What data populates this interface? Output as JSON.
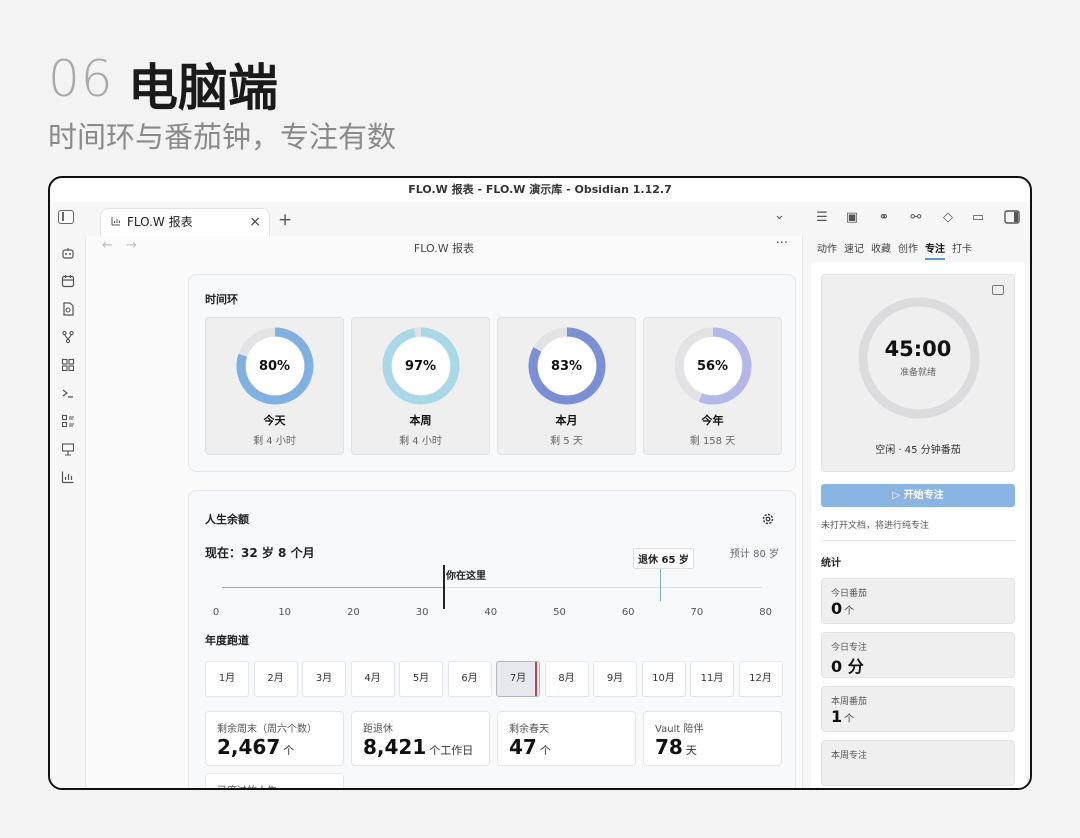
{
  "hero": {
    "number": "06",
    "title": "电脑端",
    "subtitle": "时间环与番茄钟，专注有数"
  },
  "window": {
    "title": "FLO.W 报表 - FLO.W 演示库 - Obsidian 1.12.7"
  },
  "tabs": {
    "active_label": "FLO.W 报表",
    "close": "×",
    "new": "+",
    "more": "⌄"
  },
  "navbar": {
    "back": "←",
    "forward": "→",
    "title": "FLO.W 报表",
    "more": "···"
  },
  "time_rings": {
    "title": "时间环",
    "items": [
      {
        "pct_label": "80%",
        "pct": 0.8,
        "label": "今天",
        "sub": "剩 4 小时",
        "color": "#7fb0e0"
      },
      {
        "pct_label": "97%",
        "pct": 0.97,
        "label": "本周",
        "sub": "剩 4 小时",
        "color": "#a9d8e8"
      },
      {
        "pct_label": "83%",
        "pct": 0.83,
        "label": "本月",
        "sub": "剩 5 天",
        "color": "#7b8fd6"
      },
      {
        "pct_label": "56%",
        "pct": 0.56,
        "label": "今年",
        "sub": "剩 158 天",
        "color": "#b4b8e8"
      }
    ]
  },
  "life": {
    "title": "人生余额",
    "now": "现在：32 岁 8 个月",
    "estimate": "预计 80 岁",
    "here_label": "你在这里",
    "retire_label": "退休 65 岁",
    "ticks": [
      "0",
      "10",
      "20",
      "30",
      "40",
      "50",
      "60",
      "70",
      "80"
    ],
    "year_title": "年度跑道",
    "months": [
      "1月",
      "2月",
      "3月",
      "4月",
      "5月",
      "6月",
      "7月",
      "8月",
      "9月",
      "10月",
      "11月",
      "12月"
    ],
    "current_month_index": 6,
    "stats": [
      {
        "label": "剩余周末（周六个数）",
        "value": "2,467",
        "unit": "个"
      },
      {
        "label": "距退休",
        "value": "8,421",
        "unit": "个工作日"
      },
      {
        "label": "剩余春天",
        "value": "47",
        "unit": "个"
      },
      {
        "label": "Vault 陪伴",
        "value": "78",
        "unit": "天"
      }
    ],
    "last_stat_label": "已度过的人生"
  },
  "side": {
    "tabs": [
      "动作",
      "速记",
      "收藏",
      "创作",
      "专注",
      "打卡"
    ],
    "active_tab": "专注",
    "timer": {
      "time": "45:00",
      "status": "准备就绪",
      "mode": "空闲 · 45 分钟番茄"
    },
    "start_button": "▷ 开始专注",
    "hint": "未打开文档，将进行纯专注",
    "stats_title": "统计",
    "stats": [
      {
        "label": "今日番茄",
        "value": "0",
        "unit": "个"
      },
      {
        "label": "今日专注",
        "value": "0 分",
        "unit": ""
      },
      {
        "label": "本周番茄",
        "value": "1",
        "unit": "个"
      },
      {
        "label": "本周专注",
        "value": "",
        "unit": ""
      }
    ]
  }
}
